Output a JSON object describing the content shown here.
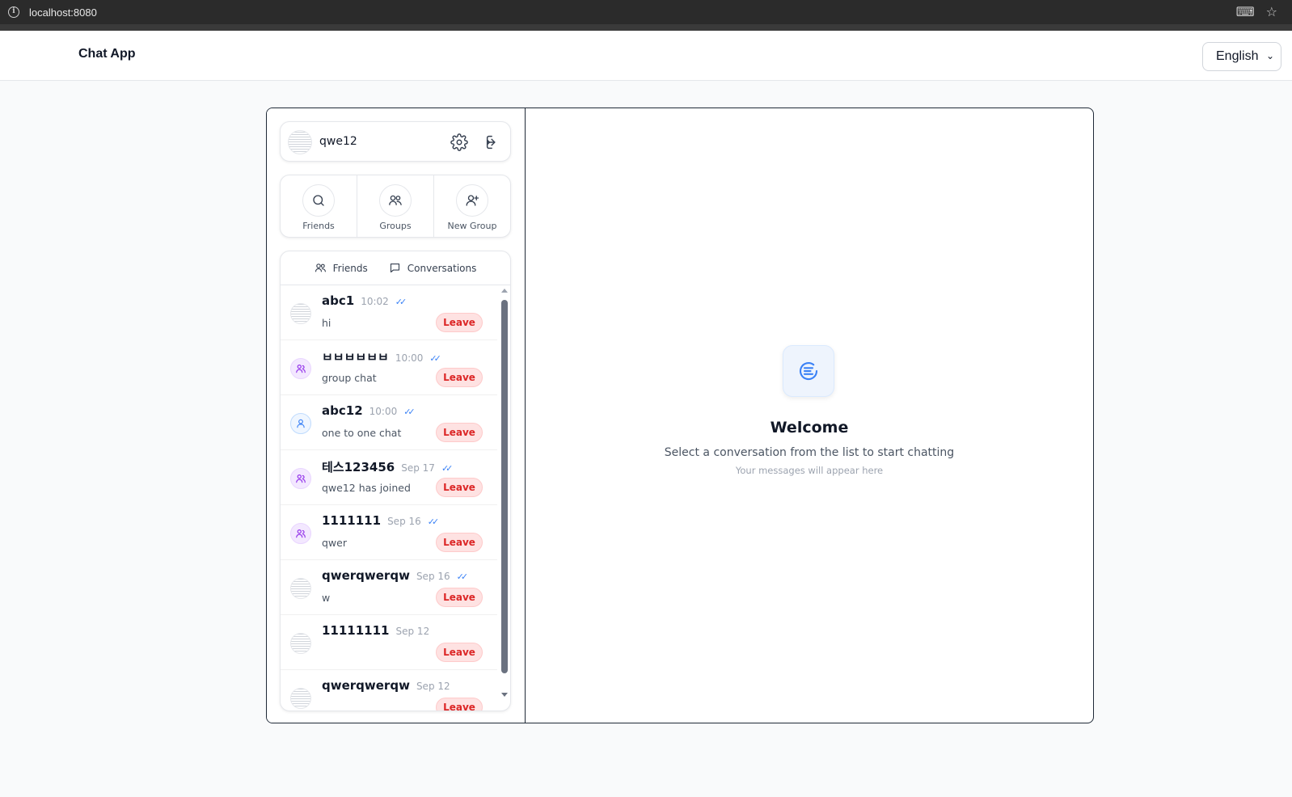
{
  "browser": {
    "url": "localhost:8080"
  },
  "header": {
    "app_title": "Chat App",
    "language": "English"
  },
  "user": {
    "name": "qwe12"
  },
  "actions": [
    {
      "label": "Friends",
      "icon": "search-icon"
    },
    {
      "label": "Groups",
      "icon": "users-icon"
    },
    {
      "label": "New Group",
      "icon": "user-plus-icon"
    }
  ],
  "tabs": {
    "friends": "Friends",
    "conversations": "Conversations"
  },
  "conversations": [
    {
      "name": "abc1",
      "time": "10:02",
      "preview": "hi",
      "avatar": "image",
      "read": true,
      "action": "Leave"
    },
    {
      "name": "ㅂㅂㅂㅂㅂㅂ",
      "time": "10:00",
      "preview": "group chat",
      "avatar": "group",
      "read": true,
      "action": "Leave"
    },
    {
      "name": "abc12",
      "time": "10:00",
      "preview": "one to one chat",
      "avatar": "user",
      "read": true,
      "action": "Leave"
    },
    {
      "name": "테스123456",
      "time": "Sep 17",
      "preview": "qwe12 has joined",
      "avatar": "group",
      "read": true,
      "action": "Leave"
    },
    {
      "name": "1111111",
      "time": "Sep 16",
      "preview": "qwer",
      "avatar": "group",
      "read": true,
      "action": "Leave"
    },
    {
      "name": "qwerqwerqw",
      "time": "Sep 16",
      "preview": "w",
      "avatar": "image",
      "read": true,
      "action": "Leave"
    },
    {
      "name": "11111111",
      "time": "Sep 12",
      "preview": "",
      "avatar": "image",
      "read": false,
      "action": "Leave"
    },
    {
      "name": "qwerqwerqw",
      "time": "Sep 12",
      "preview": "",
      "avatar": "image",
      "read": false,
      "action": "Leave"
    }
  ],
  "welcome": {
    "title": "Welcome",
    "subtitle": "Select a conversation from the list to start chatting",
    "hint": "Your messages will appear here"
  },
  "colors": {
    "accent": "#3b82f6",
    "leave": "#dc2626",
    "leave_bg": "#fee2e2",
    "group_icon": "#9333ea"
  }
}
